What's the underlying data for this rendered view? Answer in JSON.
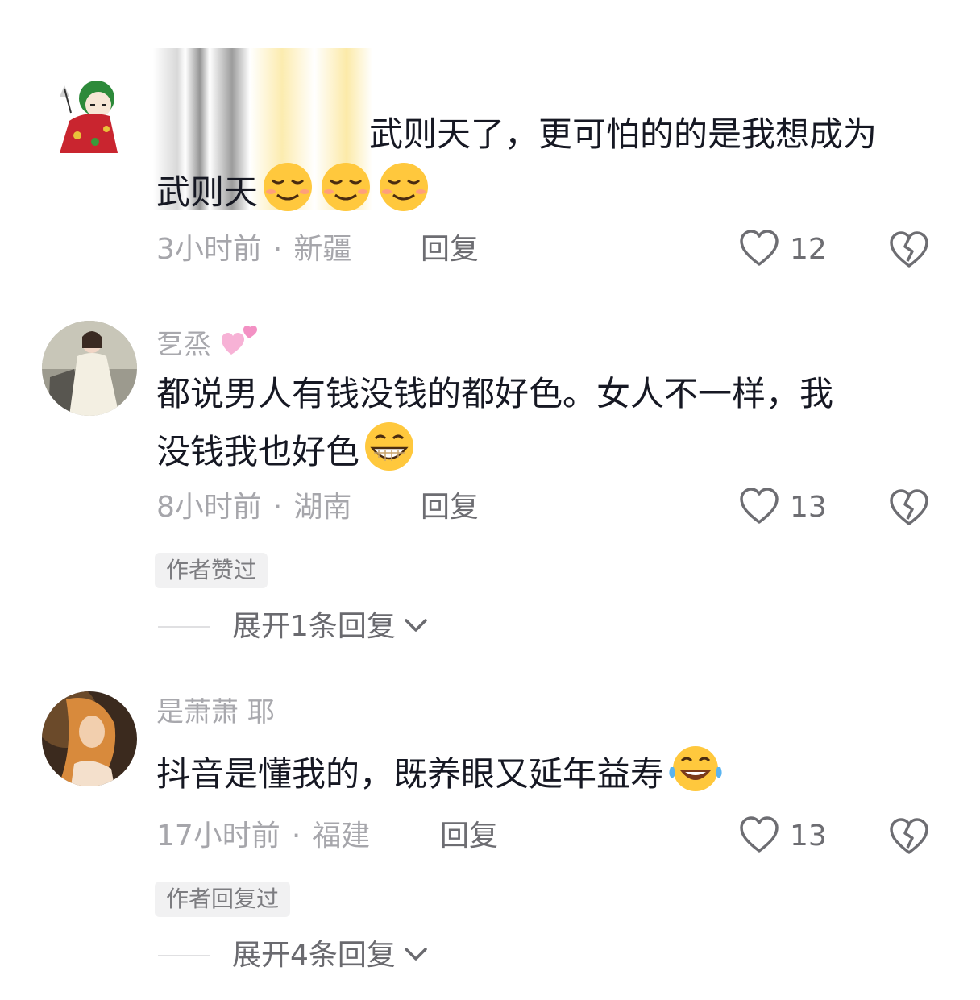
{
  "comments": [
    {
      "username": "",
      "text_visible": "武则天了，更可怕的的是我想成为",
      "text_line2": "武则天",
      "emojis": [
        "relieved-face-emoji",
        "relieved-face-emoji",
        "relieved-face-emoji"
      ],
      "time": "3小时前",
      "location": "新疆",
      "reply_label": "回复",
      "likes": "12",
      "tag": "",
      "expand_label": ""
    },
    {
      "username": "乭烝",
      "text": "都说男人有钱没钱的都好色。女人不一样，我",
      "text_line2": "没钱我也好色",
      "emojis": [
        "grinning-face-emoji"
      ],
      "time": "8小时前",
      "location": "湖南",
      "reply_label": "回复",
      "likes": "13",
      "tag": "作者赞过",
      "expand_label": "展开1条回复"
    },
    {
      "username": "是萧萧 耶",
      "text": "抖音是懂我的，既养眼又延年益寿",
      "emojis": [
        "tears-of-joy-emoji"
      ],
      "time": "17小时前",
      "location": "福建",
      "reply_label": "回复",
      "likes": "13",
      "tag": "作者回复过",
      "expand_label": "展开4条回复"
    }
  ],
  "meta_separator": "·",
  "colors": {
    "like_gray": "#6d6d72",
    "meta_gray": "#a6a6ab",
    "text": "#161823"
  }
}
